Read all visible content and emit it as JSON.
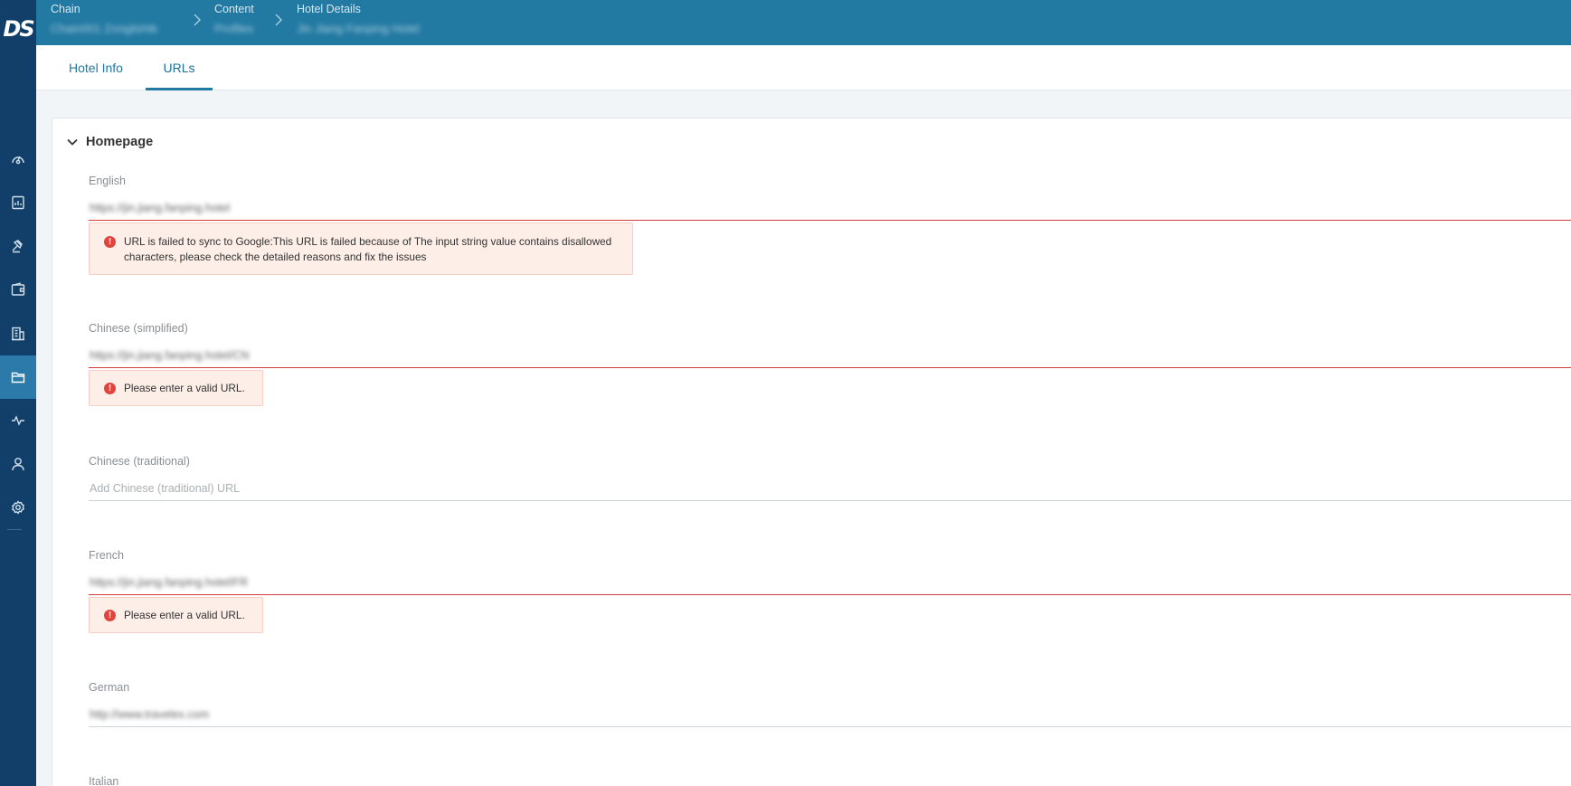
{
  "brand": {
    "logo": "DS"
  },
  "header": {
    "breadcrumbs": [
      {
        "label": "Chain",
        "value": "Chain001 Zonglishtk"
      },
      {
        "label": "Content",
        "value": "Profiles"
      },
      {
        "label": "Hotel Details",
        "value": "Jin Jiang Fanping Hotel"
      }
    ]
  },
  "tabs": [
    {
      "label": "Hotel Info"
    },
    {
      "label": "URLs"
    }
  ],
  "section": {
    "title": "Homepage"
  },
  "fields": [
    {
      "label": "English",
      "value": "https://jin.jiang.fanping.hotel",
      "placeholder": "",
      "error": "URL is failed to sync to Google:This URL is failed because of The input string value contains disallowed characters, please check the detailed reasons and fix the issues"
    },
    {
      "label": "Chinese (simplified)",
      "value": "https://jin.jiang.fanping.hotel/CN",
      "placeholder": "",
      "error": "Please enter a valid URL."
    },
    {
      "label": "Chinese (traditional)",
      "value": "",
      "placeholder": "Add Chinese (traditional) URL",
      "error": ""
    },
    {
      "label": "French",
      "value": "https://jin.jiang.fanping.hotel/FR",
      "placeholder": "",
      "error": "Please enter a valid URL."
    },
    {
      "label": "German",
      "value": "http://www.travelex.com",
      "placeholder": "",
      "error": ""
    },
    {
      "label": "Italian",
      "value": "",
      "placeholder": "",
      "error": ""
    }
  ],
  "colors": {
    "sidebar": "#123f69",
    "header": "#2279a2",
    "accent": "#2279a2",
    "error": "#d73a3a",
    "error_bg": "#fdeee8"
  },
  "sidebar": {
    "items": [
      {
        "icon": "dashboard-gauge-icon"
      },
      {
        "icon": "report-icon"
      },
      {
        "icon": "gavel-icon"
      },
      {
        "icon": "wallet-icon"
      },
      {
        "icon": "building-icon"
      },
      {
        "icon": "folder-icon",
        "active": true
      },
      {
        "icon": "activity-icon"
      },
      {
        "icon": "user-icon"
      },
      {
        "icon": "settings-icon"
      }
    ]
  }
}
